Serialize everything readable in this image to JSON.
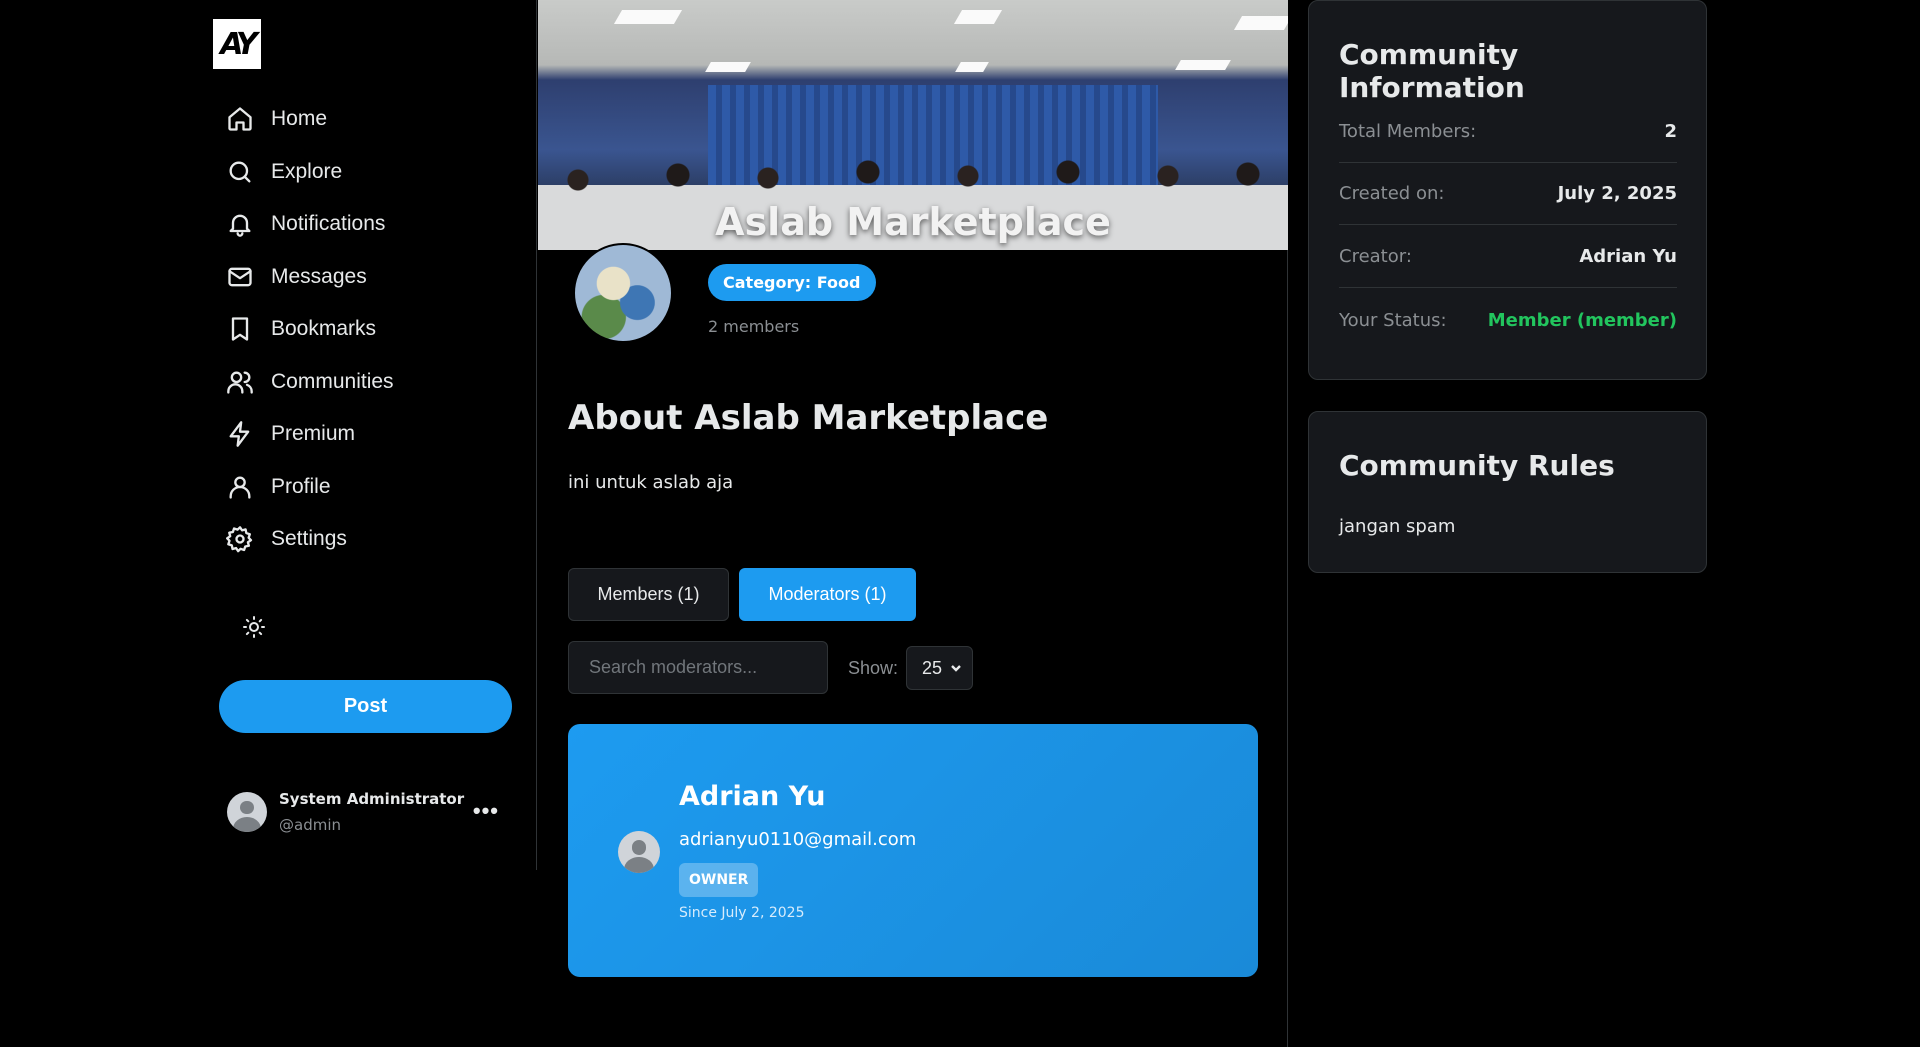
{
  "nav": {
    "items": [
      {
        "label": "Home",
        "icon": "home-icon"
      },
      {
        "label": "Explore",
        "icon": "search-icon"
      },
      {
        "label": "Notifications",
        "icon": "bell-icon"
      },
      {
        "label": "Messages",
        "icon": "mail-icon"
      },
      {
        "label": "Bookmarks",
        "icon": "bookmark-icon"
      },
      {
        "label": "Communities",
        "icon": "users-icon"
      },
      {
        "label": "Premium",
        "icon": "lightning-icon"
      },
      {
        "label": "Profile",
        "icon": "user-icon"
      },
      {
        "label": "Settings",
        "icon": "gear-icon"
      }
    ],
    "post_label": "Post",
    "logo_text": "AY"
  },
  "current_user": {
    "name": "System Administrator",
    "handle": "@admin",
    "more_icon": "more-dots-icon"
  },
  "community": {
    "name": "Aslab Marketplace",
    "category": "Category: Food",
    "members_text": "2 members",
    "about_title": "About Aslab Marketplace",
    "description": "ini untuk aslab aja"
  },
  "tabs": {
    "members": "Members (1)",
    "moderators": "Moderators (1)",
    "active": "moderators"
  },
  "filters": {
    "search_placeholder": "Search moderators...",
    "show_label": "Show:",
    "show_value": "25"
  },
  "moderators": [
    {
      "name": "Adrian Yu",
      "email": "adrianyu0110@gmail.com",
      "role": "OWNER",
      "since": "Since July 2, 2025"
    }
  ],
  "info": {
    "title": "Community Information",
    "rows": [
      {
        "label": "Total Members:",
        "value": "2"
      },
      {
        "label": "Created on:",
        "value": "July 2, 2025"
      },
      {
        "label": "Creator:",
        "value": "Adrian Yu"
      },
      {
        "label": "Your Status:",
        "value": "Member (member)"
      }
    ]
  },
  "rules": {
    "title": "Community Rules",
    "text": "jangan spam"
  },
  "colors": {
    "accent": "#1d9bf0",
    "status": "#22c55e",
    "background": "#000000",
    "card": "#16181c"
  }
}
